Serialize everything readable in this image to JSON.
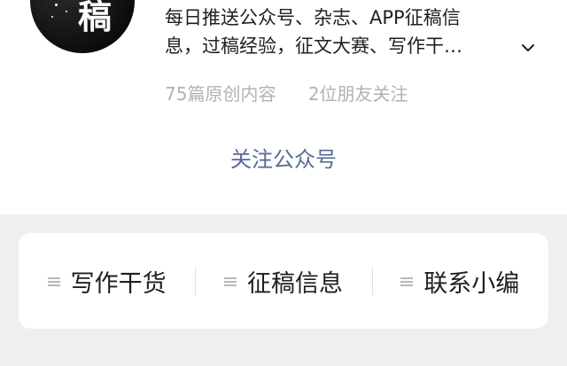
{
  "profile": {
    "avatar_glyph": "稿",
    "description_lines": [
      "每日推送公众号、杂志、APP征稿信",
      "息，过稿经验，征文大赛、写作干…"
    ],
    "stats": {
      "articles": "75篇原创内容",
      "friends_following": "2位朋友关注"
    },
    "follow_label": "关注公众号"
  },
  "menu": {
    "items": [
      {
        "label": "写作干货"
      },
      {
        "label": "征稿信息"
      },
      {
        "label": "联系小编"
      }
    ]
  },
  "icons": {
    "expand": "chevron-down-icon",
    "menu": "menu-lines-icon"
  },
  "colors": {
    "link": "#576b95",
    "text": "#1f1f1f",
    "muted": "#b2b2b2",
    "background": "#efefef"
  }
}
